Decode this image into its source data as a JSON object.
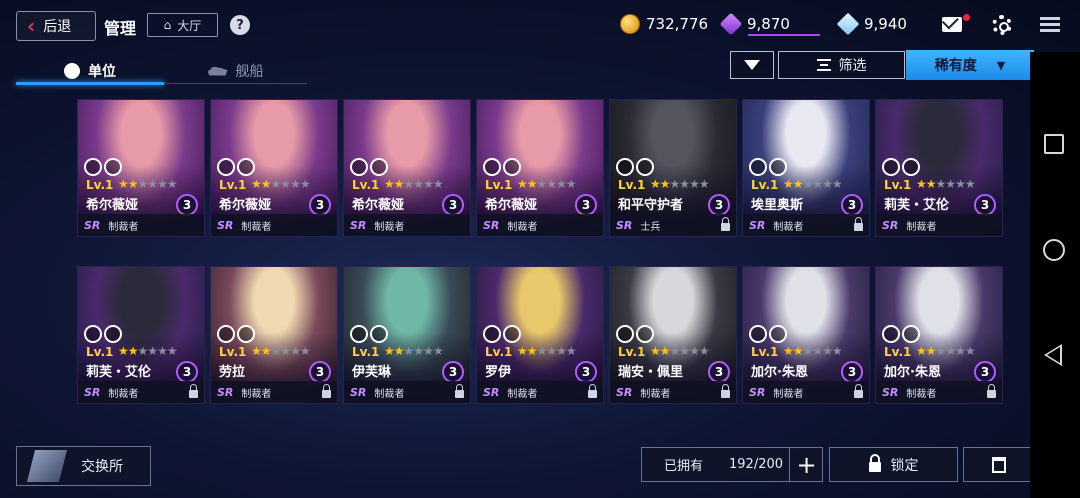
{
  "header": {
    "back_label": "后退",
    "title": "管理",
    "lobby_label": "大厅",
    "help_label": "?"
  },
  "currencies": {
    "coins": "732,776",
    "gems": "9,870",
    "crystals": "9,940"
  },
  "tabs": {
    "units": "单位",
    "ships": "舰船"
  },
  "toolbar": {
    "filter_label": "筛选",
    "sort_label": "稀有度"
  },
  "cards": [
    {
      "name": "希尔薇娅",
      "level": "Lv.1",
      "stars": 2,
      "count": "3",
      "rarity": "SR",
      "class": "制裁者",
      "locked": false,
      "art": [
        "#7a3a8a",
        "#e79aa8",
        "#3a1550"
      ]
    },
    {
      "name": "希尔薇娅",
      "level": "Lv.1",
      "stars": 2,
      "count": "3",
      "rarity": "SR",
      "class": "制裁者",
      "locked": false,
      "art": [
        "#7a3a8a",
        "#e79aa8",
        "#3a1550"
      ]
    },
    {
      "name": "希尔薇娅",
      "level": "Lv.1",
      "stars": 2,
      "count": "3",
      "rarity": "SR",
      "class": "制裁者",
      "locked": false,
      "art": [
        "#7a3a8a",
        "#e79aa8",
        "#3a1550"
      ]
    },
    {
      "name": "希尔薇娅",
      "level": "Lv.1",
      "stars": 2,
      "count": "3",
      "rarity": "SR",
      "class": "制裁者",
      "locked": false,
      "art": [
        "#7a3a8a",
        "#e79aa8",
        "#3a1550"
      ]
    },
    {
      "name": "和平守护者",
      "level": "Lv.1",
      "stars": 2,
      "count": "3",
      "rarity": "SR",
      "class": "士兵",
      "locked": true,
      "art": [
        "#2a2a33",
        "#555560",
        "#141418"
      ]
    },
    {
      "name": "埃里奥斯",
      "level": "Lv.1",
      "stars": 2,
      "count": "3",
      "rarity": "SR",
      "class": "制裁者",
      "locked": true,
      "art": [
        "#3a3f7a",
        "#e8e8f2",
        "#1b2450"
      ]
    },
    {
      "name": "莉芙・艾伦",
      "level": "Lv.1",
      "stars": 2,
      "count": "3",
      "rarity": "SR",
      "class": "制裁者",
      "locked": false,
      "art": [
        "#4a2a6a",
        "#2a2a3a",
        "#1a1a40"
      ]
    },
    {
      "name": "莉芙・艾伦",
      "level": "Lv.1",
      "stars": 2,
      "count": "3",
      "rarity": "SR",
      "class": "制裁者",
      "locked": true,
      "art": [
        "#4a2a6a",
        "#2a2a3a",
        "#1a1a40"
      ]
    },
    {
      "name": "劳拉",
      "level": "Lv.1",
      "stars": 2,
      "count": "3",
      "rarity": "SR",
      "class": "制裁者",
      "locked": true,
      "art": [
        "#7a4a5a",
        "#f0d8b0",
        "#2a1a24"
      ]
    },
    {
      "name": "伊芙琳",
      "level": "Lv.1",
      "stars": 2,
      "count": "3",
      "rarity": "SR",
      "class": "制裁者",
      "locked": true,
      "art": [
        "#3a4a55",
        "#6fb8a8",
        "#1a2025"
      ]
    },
    {
      "name": "罗伊",
      "level": "Lv.1",
      "stars": 2,
      "count": "3",
      "rarity": "SR",
      "class": "制裁者",
      "locked": true,
      "art": [
        "#4a2a6a",
        "#e8c86a",
        "#241436"
      ]
    },
    {
      "name": "瑞安・佩里",
      "level": "Lv.1",
      "stars": 2,
      "count": "3",
      "rarity": "SR",
      "class": "制裁者",
      "locked": true,
      "art": [
        "#3a3a44",
        "#d8d8dc",
        "#18181e"
      ]
    },
    {
      "name": "加尔·朱恩",
      "level": "Lv.1",
      "stars": 2,
      "count": "3",
      "rarity": "SR",
      "class": "制裁者",
      "locked": true,
      "art": [
        "#4a3a6a",
        "#e0e0e8",
        "#1e1a3a"
      ]
    },
    {
      "name": "加尔·朱恩",
      "level": "Lv.1",
      "stars": 2,
      "count": "3",
      "rarity": "SR",
      "class": "制裁者",
      "locked": true,
      "art": [
        "#4a3a6a",
        "#e0e0e8",
        "#1e1a3a"
      ]
    }
  ],
  "footer": {
    "exchange_label": "交换所",
    "owned_label": "已拥有",
    "owned_value": "192/200",
    "add_label": "+",
    "lock_label": "锁定"
  },
  "colors": {
    "accent_blue": "#2e9cff",
    "gem_purple": "#a64bf0",
    "star_gold": "#ffc21a"
  }
}
